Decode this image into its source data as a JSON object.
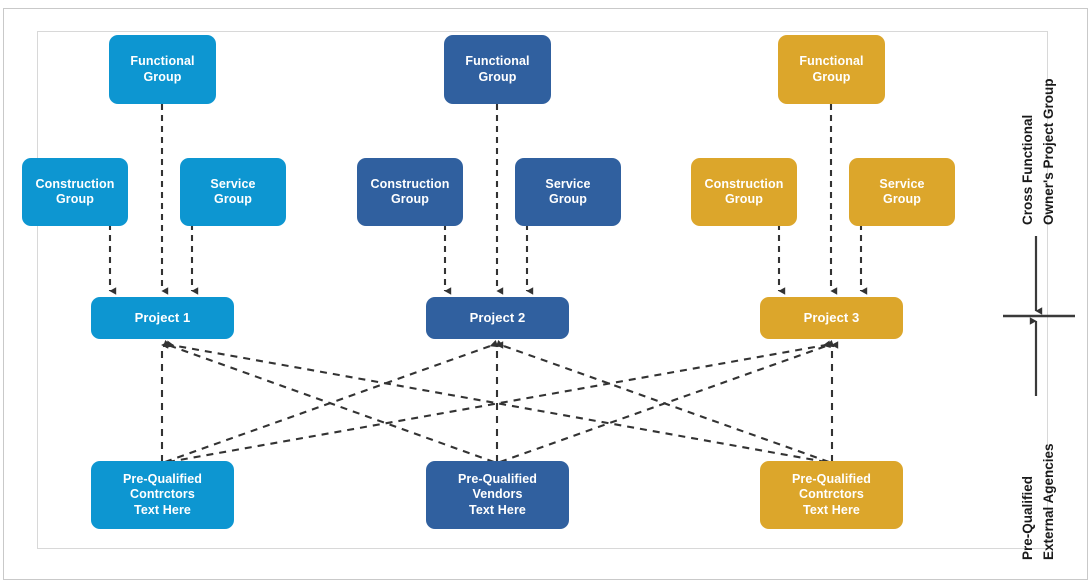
{
  "diagram": {
    "title": "Cross Functional Owner's Project Group and Pre-Qualified External Agencies",
    "colors": {
      "column_1": "#0d96d1",
      "column_2": "#30609f",
      "column_3": "#dca62b",
      "connector": "#333333",
      "frame_outer": "#c9c9c9",
      "frame_inner": "#d8d8d8",
      "node_text": "#ffffff",
      "label_text": "#1a1a1a"
    },
    "columns": [
      {
        "id": "column-1",
        "color_key": "column_1",
        "functional_group": "Functional\nGroup",
        "functional_group_line_1": "Functional",
        "functional_group_line_2": "Group",
        "construction_group_line_1": "Construction",
        "construction_group_line_2": "Group",
        "service_group_line_1": "Service",
        "service_group_line_2": "Group",
        "project": "Project 1",
        "prequalified_line_1": "Pre-Qualified",
        "prequalified_line_2": "Contrctors",
        "prequalified_line_3": "Text Here"
      },
      {
        "id": "column-2",
        "color_key": "column_2",
        "functional_group_line_1": "Functional",
        "functional_group_line_2": "Group",
        "construction_group_line_1": "Construction",
        "construction_group_line_2": "Group",
        "service_group_line_1": "Service",
        "service_group_line_2": "Group",
        "project": "Project 2",
        "prequalified_line_1": "Pre-Qualified",
        "prequalified_line_2": "Vendors",
        "prequalified_line_3": "Text Here"
      },
      {
        "id": "column-3",
        "color_key": "column_3",
        "functional_group_line_1": "Functional",
        "functional_group_line_2": "Group",
        "construction_group_line_1": "Construction",
        "construction_group_line_2": "Group",
        "service_group_line_1": "Service",
        "service_group_line_2": "Group",
        "project": "Project 3",
        "prequalified_line_1": "Pre-Qualified",
        "prequalified_line_2": "Contrctors",
        "prequalified_line_3": "Text Here"
      }
    ],
    "side_labels": {
      "upper_line_1": "Cross Functional",
      "upper_line_2": "Owner's Project Group",
      "lower_line_1": "Pre-Qualified",
      "lower_line_2": "External Agencies"
    }
  }
}
